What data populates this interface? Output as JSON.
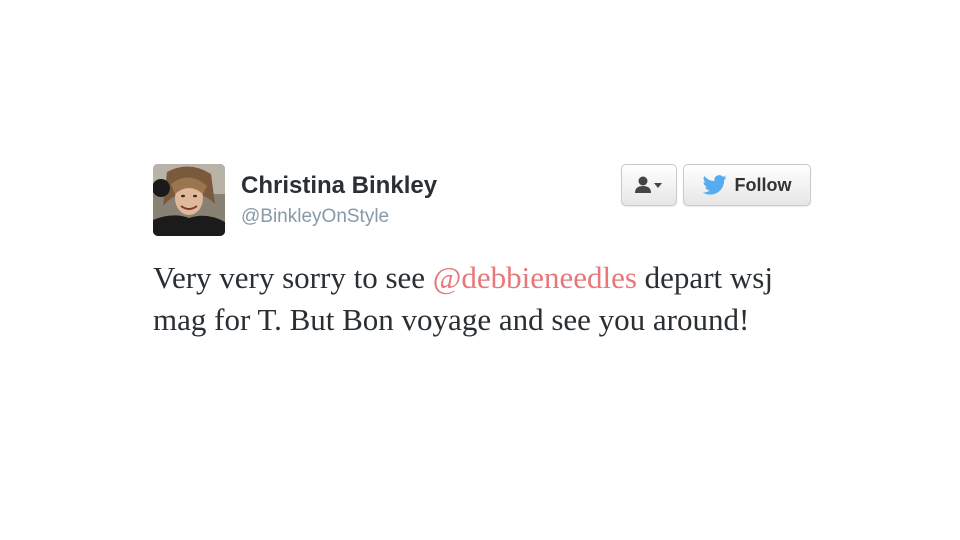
{
  "author": {
    "name": "Christina Binkley",
    "handle": "@BinkleyOnStyle",
    "avatar_icon": "profile-photo"
  },
  "actions": {
    "user_menu_icon": "user-dropdown-icon",
    "follow_label": "Follow",
    "follow_icon": "twitter-bird-icon"
  },
  "tweet": {
    "text_before": "Very very sorry to see ",
    "mention": "@debbieneedles",
    "text_after": " depart wsj mag for T. But Bon voyage and see you around!"
  },
  "colors": {
    "mention": "#e8777a",
    "bird": "#55acee",
    "name": "#292f33",
    "handle": "#8899a6"
  }
}
